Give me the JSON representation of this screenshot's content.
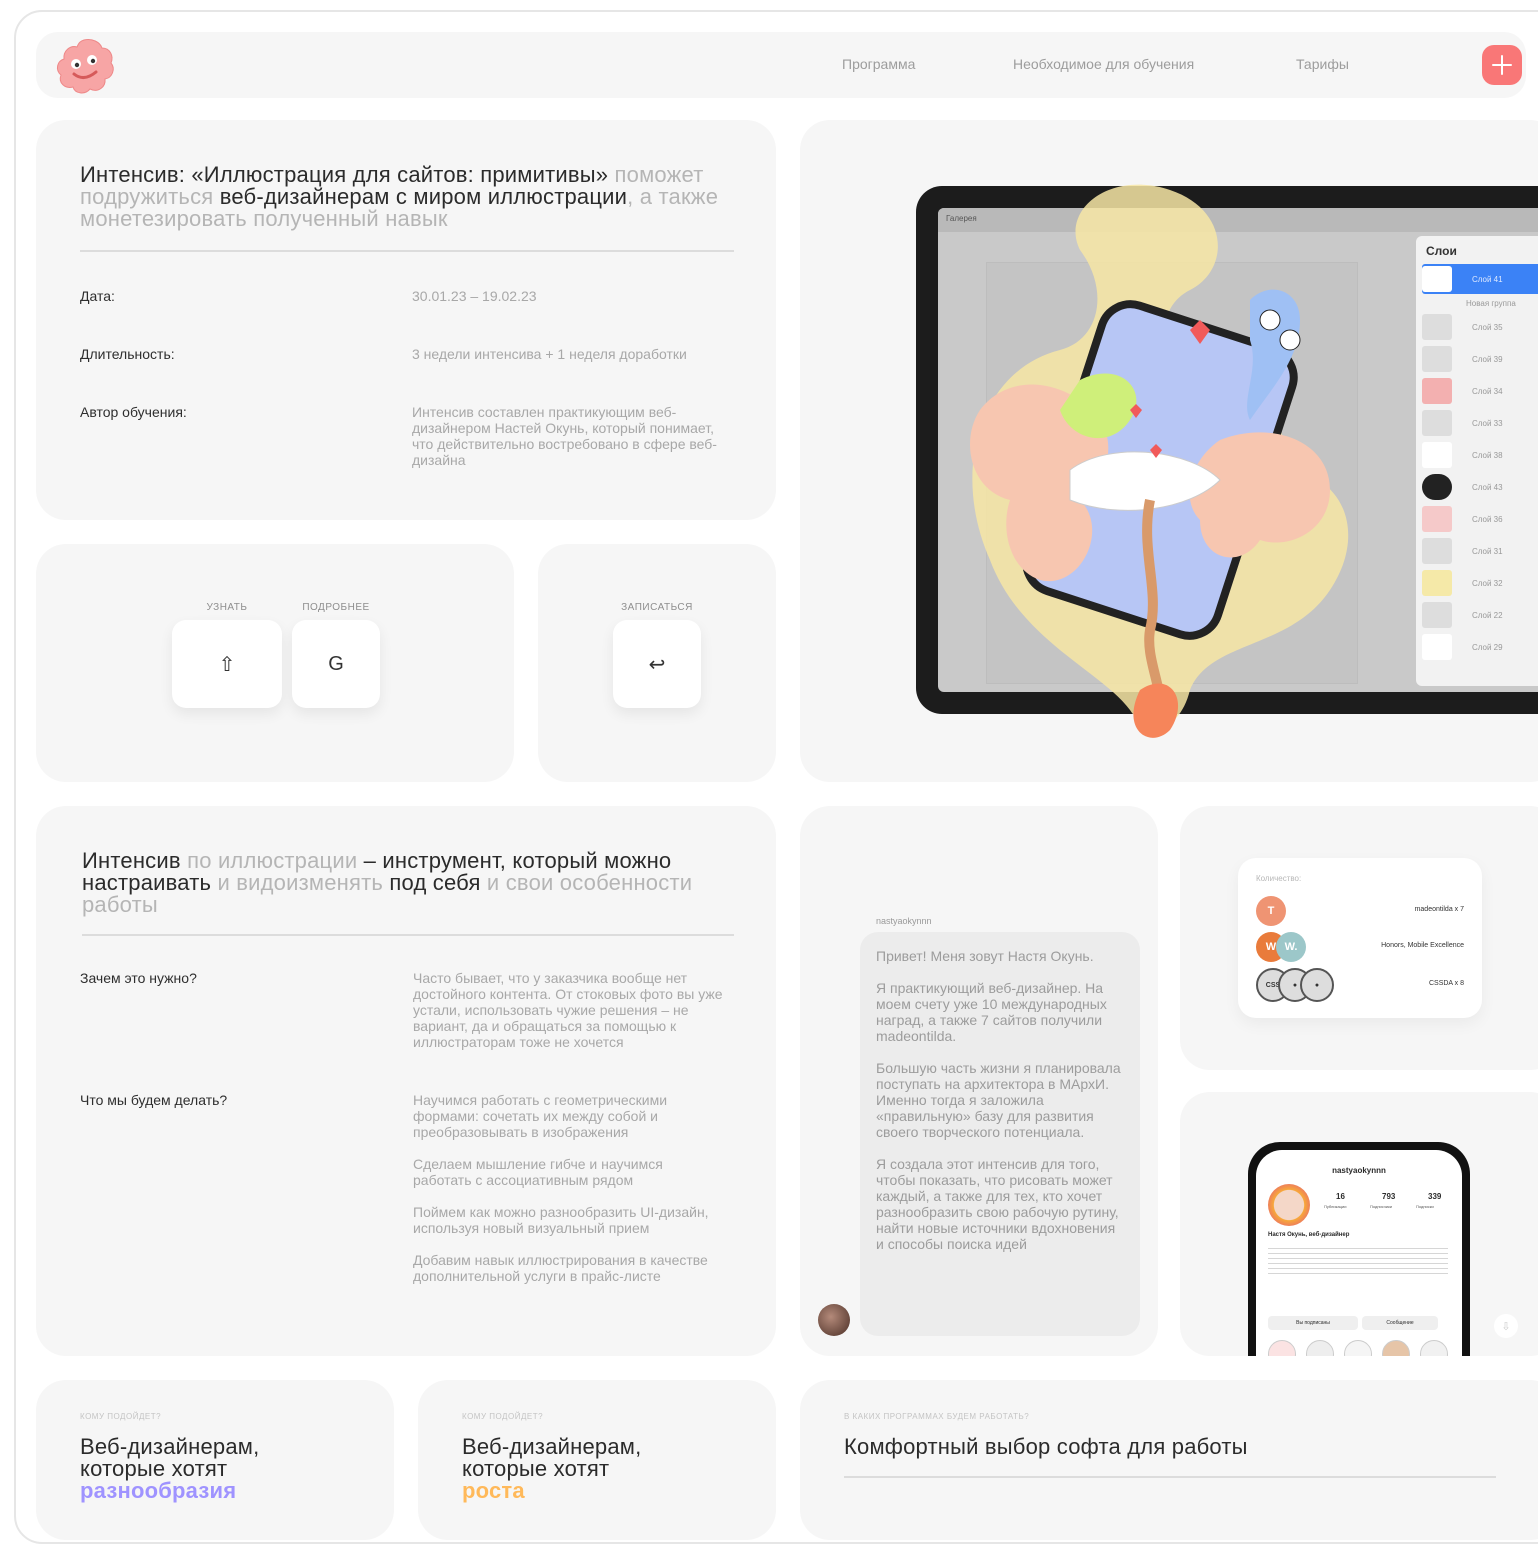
{
  "nav": {
    "links": [
      "Программа",
      "Необходимое для обучения",
      "Тарифы"
    ],
    "plus_label": "+"
  },
  "intro": {
    "title_dark_1": "Интенсив: «Иллюстрация для сайтов: примитивы»",
    "title_muted_1": " поможет подружиться",
    "title_dark_2": " веб-дизайнерам с миром иллюстрации",
    "title_muted_2": ", а также монетезировать полученный навык",
    "rows": [
      {
        "label": "Дата:",
        "value": "30.01.23 – 19.02.23"
      },
      {
        "label": "Длительность:",
        "value": "3 недели интенсива + 1 неделя доработки"
      },
      {
        "label": "Автор обучения:",
        "value": "Интенсив составлен практикующим веб-дизайнером Настей Окунь, который понимает, что действительно востребовано в сфере веб-дизайна"
      }
    ]
  },
  "keys": {
    "learn_caption": "УЗНАТЬ",
    "learn_key": "⇧",
    "more_caption": "ПОДРОБНЕЕ",
    "more_key": "G",
    "enroll_caption": "ЗАПИСАТЬСЯ",
    "enroll_key": "↩"
  },
  "tablet": {
    "layers_title": "Слои",
    "layer_labels": [
      "Слой 41",
      "Новая группа",
      "Слой 35",
      "Слой 39",
      "Слой 34",
      "Слой 33",
      "Слой 38",
      "Слой 43",
      "Слой 36",
      "Слой 31",
      "Слой 32",
      "Слой 22",
      "Слой 29"
    ],
    "toolbar_label": "Галерея"
  },
  "tool": {
    "t1": "Интенсив",
    "t2": " по иллюстрации",
    "t3": " – инструмент, который можно настраивать",
    "t4": " и видоизменять",
    "t5": " под себя",
    "t6": " и свои особенности работы",
    "why_label": "Зачем это нужно?",
    "why_text": "Часто бывает, что у заказчика вообще нет достойного контента. От стоковых фото вы уже устали, использовать чужие решения – не вариант, да и обращаться за помощью к иллюстраторам тоже не хочется",
    "what_label": "Что мы будем делать?",
    "what_items": [
      "Научимся работать с геометрическими формами: сочетать их между собой и преобразовывать в изображения",
      "Сделаем мышление гибче и научимся работать с ассоциативным рядом",
      "Поймем как можно разнообразить UI-дизайн, используя новый визуальный прием",
      "Добавим навык иллюстрирования в качестве дополнительной услуги в прайс-листе"
    ]
  },
  "chat": {
    "username": "nastyaokynnn",
    "messages": [
      "Привет! Меня зовут Настя Окунь.",
      "Я практикующий веб-дизайнер. На моем счету уже 10 международных наград, а также 7 сайтов получили madeontilda.",
      "Большую часть жизни я планировала поступать на архитектора в МАрхИ. Именно тогда я заложила «правильную» базу для развития своего творческого потенциала.",
      "Я создала этот интенсив для того, чтобы показать, что рисовать может каждый, а также для тех, кто хочет разнообразить свою рабочую рутину, найти новые источники вдохновения и способы поиска идей"
    ]
  },
  "awards": {
    "caption": "Количество:",
    "items": [
      {
        "badge": "T",
        "label": "madeontilda x 7"
      },
      {
        "badge": "W.",
        "label": "Honors, Mobile Excellence"
      },
      {
        "badge": "CSS",
        "label": "CSSDA x 8"
      }
    ]
  },
  "profile": {
    "handle": "nastyaokynnn",
    "stats": [
      "16",
      "793",
      "339"
    ],
    "stat_labels": [
      "Публикации",
      "Подписчики",
      "Подписки"
    ],
    "name": "Настя Окунь, веб-дизайнер",
    "button_follow": "Вы подписаны",
    "button_message": "Сообщение"
  },
  "bottom": {
    "a_caption": "КОМУ ПОДОЙДЕТ?",
    "a_title": "Веб-дизайнерам, которые хотят",
    "a_accent": "разнообразия",
    "a_accent_color": "#9f93ff",
    "b_caption": "КОМУ ПОДОЙДЕТ?",
    "b_title": "Веб-дизайнерам, которые хотят",
    "b_accent": "роста",
    "b_accent_color": "#ffb95a",
    "c_caption": "В КАКИХ ПРОГРАММАХ БУДЕМ РАБОТАТЬ?",
    "c_title": "Комфортный выбор софта для работы"
  },
  "colors": {
    "accent": "#f97777",
    "card": "#f6f6f6",
    "muted_text": "#b5b5b5"
  }
}
